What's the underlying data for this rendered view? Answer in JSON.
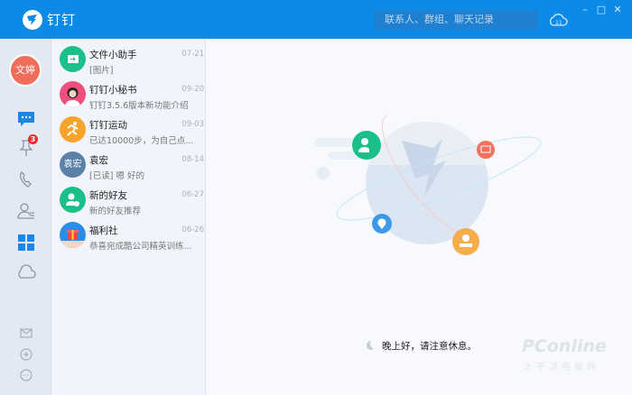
{
  "titlebar": {
    "app_name": "钉钉",
    "search_placeholder": "联系人、群组、聊天记录",
    "cloud_label": "11"
  },
  "nav": {
    "user_avatar": "文婷",
    "ding_badge": "3"
  },
  "conversations": [
    {
      "name": "文件小助手",
      "time": "07-21",
      "preview": "[图片]",
      "color": "#1bbf8a"
    },
    {
      "name": "钉钉小秘书",
      "time": "09-20",
      "preview": "钉钉3.5.6版本新功能介绍",
      "color": "#ee4f7d"
    },
    {
      "name": "钉钉运动",
      "time": "09-03",
      "preview": "已达10000步，为自己点...",
      "color": "#f7a42a"
    },
    {
      "name": "袁宏",
      "time": "08-14",
      "preview": "[已读] 嗯 好的",
      "color": "#5b82a6",
      "avatar_text": "袁宏"
    },
    {
      "name": "新的好友",
      "time": "06-27",
      "preview": "新的好友推荐",
      "color": "#1bbf8a"
    },
    {
      "name": "福利社",
      "time": "06-26",
      "preview": "恭喜宛成酷公司精英训练...",
      "color": "#2a8ee6"
    }
  ],
  "main": {
    "greeting": "晚上好，请注意休息。",
    "watermark": "PConline",
    "watermark_sub": "太平洋电脑网"
  }
}
